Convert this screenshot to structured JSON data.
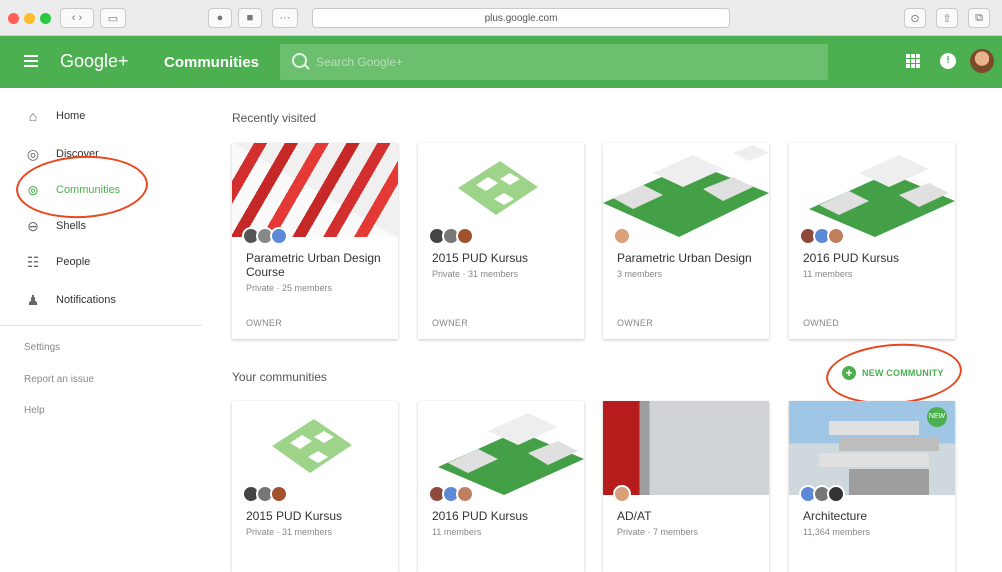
{
  "browser": {
    "url": "plus.google.com"
  },
  "header": {
    "brand": "Google+",
    "section": "Communities",
    "search_placeholder": "Search Google+"
  },
  "sidebar": {
    "items": [
      {
        "label": "Home",
        "icon": "home-icon"
      },
      {
        "label": "Discover",
        "icon": "compass-icon"
      },
      {
        "label": "Communities",
        "icon": "communities-icon",
        "active": true
      },
      {
        "label": "Shells",
        "icon": "collections-icon"
      },
      {
        "label": "People",
        "icon": "people-icon"
      },
      {
        "label": "Notifications",
        "icon": "bell-icon"
      }
    ],
    "links": [
      "Settings",
      "Report an issue",
      "Help"
    ]
  },
  "recent": {
    "heading": "Recently visited",
    "cards": [
      {
        "name": "Parametric Urban Design Course",
        "meta": "Private · 25 members",
        "role": "OWNER"
      },
      {
        "name": "2015 PUD Kursus",
        "meta": "Private · 31 members",
        "role": "OWNER"
      },
      {
        "name": "Parametric Urban Design",
        "meta": "3 members",
        "role": "OWNER"
      },
      {
        "name": "2016 PUD Kursus",
        "meta": "11 members",
        "role": "OWNED"
      }
    ]
  },
  "yours": {
    "heading": "Your communities",
    "new_label": "NEW COMMUNITY",
    "cards": [
      {
        "name": "2015 PUD Kursus",
        "meta": "Private · 31 members"
      },
      {
        "name": "2016 PUD Kursus",
        "meta": "11 members"
      },
      {
        "name": "AD/AT",
        "meta": "Private · 7 members"
      },
      {
        "name": "Architecture",
        "meta": "11,364 members",
        "badge": "NEW"
      }
    ]
  },
  "colors": {
    "brand_green": "#4caf50",
    "annotation_red": "#e8471f"
  }
}
